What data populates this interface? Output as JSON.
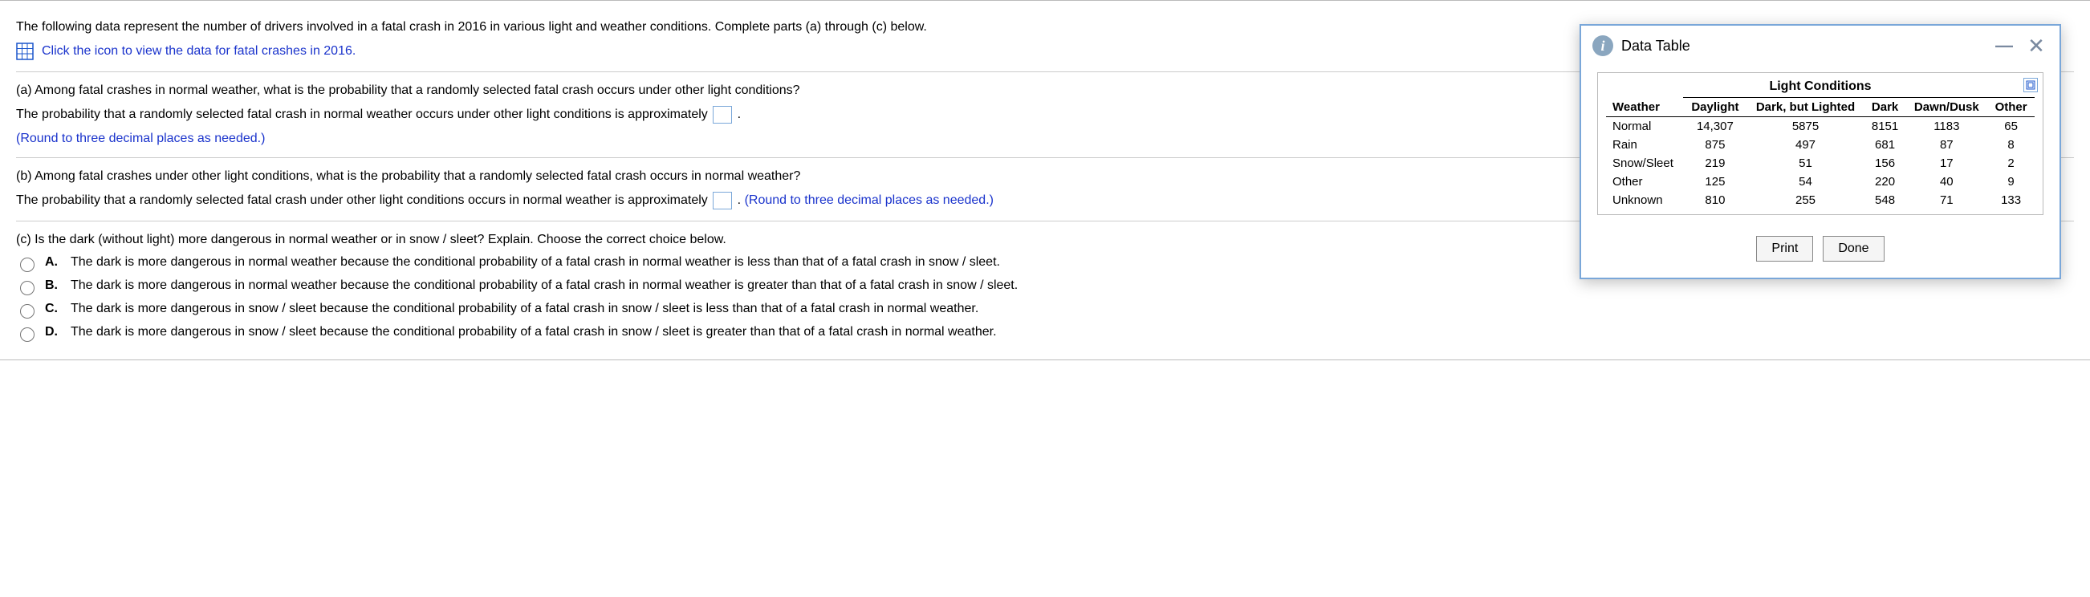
{
  "intro": "The following data represent the number of drivers involved in a fatal crash in 2016 in various light and weather conditions. Complete parts (a) through (c) below.",
  "link_text": "Click the icon to view the data for fatal crashes in 2016.",
  "partA": {
    "question": "(a) Among fatal crashes in normal weather, what is the probability that a randomly selected fatal crash occurs under other light conditions?",
    "lead": "The probability that a randomly selected fatal crash in normal weather occurs under other light conditions is approximately ",
    "tail": ".",
    "round": "(Round to three decimal places as needed.)"
  },
  "partB": {
    "question": "(b) Among fatal crashes under other light conditions, what is the probability that a randomly selected fatal crash occurs in normal weather?",
    "lead": "The probability that a randomly selected fatal crash under other light conditions occurs in normal weather is approximately ",
    "tail": ". ",
    "round": "(Round to three decimal places as needed.)"
  },
  "partC": {
    "question": "(c) Is the dark (without light) more dangerous in normal weather or in snow / sleet? Explain. Choose the correct choice below.",
    "options": {
      "A": "The dark is more dangerous in normal weather because the conditional probability of a fatal crash in normal weather is less than that of a fatal crash in snow / sleet.",
      "B": "The dark is more dangerous in normal weather because the conditional probability of a fatal crash in normal weather is greater than that of a fatal crash in snow / sleet.",
      "C": "The dark is more dangerous in snow / sleet because the conditional probability of a fatal crash in snow / sleet is less than that of a fatal crash in normal weather.",
      "D": "The dark is more dangerous in snow / sleet because the conditional probability of a fatal crash in snow / sleet is greater than that of a fatal crash in normal weather."
    }
  },
  "modal": {
    "title": "Data Table",
    "table_title": "Light Conditions",
    "headers": [
      "Weather",
      "Daylight",
      "Dark, but Lighted",
      "Dark",
      "Dawn/Dusk",
      "Other"
    ],
    "rows": [
      {
        "label": "Normal",
        "vals": [
          "14,307",
          "5875",
          "8151",
          "1183",
          "65"
        ]
      },
      {
        "label": "Rain",
        "vals": [
          "875",
          "497",
          "681",
          "87",
          "8"
        ]
      },
      {
        "label": "Snow/Sleet",
        "vals": [
          "219",
          "51",
          "156",
          "17",
          "2"
        ]
      },
      {
        "label": "Other",
        "vals": [
          "125",
          "54",
          "220",
          "40",
          "9"
        ]
      },
      {
        "label": "Unknown",
        "vals": [
          "810",
          "255",
          "548",
          "71",
          "133"
        ]
      }
    ],
    "print": "Print",
    "done": "Done"
  },
  "chart_data": {
    "type": "table",
    "title": "Light Conditions",
    "row_label": "Weather",
    "columns": [
      "Daylight",
      "Dark, but Lighted",
      "Dark",
      "Dawn/Dusk",
      "Other"
    ],
    "rows": {
      "Normal": [
        14307,
        5875,
        8151,
        1183,
        65
      ],
      "Rain": [
        875,
        497,
        681,
        87,
        8
      ],
      "Snow/Sleet": [
        219,
        51,
        156,
        17,
        2
      ],
      "Other": [
        125,
        54,
        220,
        40,
        9
      ],
      "Unknown": [
        810,
        255,
        548,
        71,
        133
      ]
    }
  }
}
